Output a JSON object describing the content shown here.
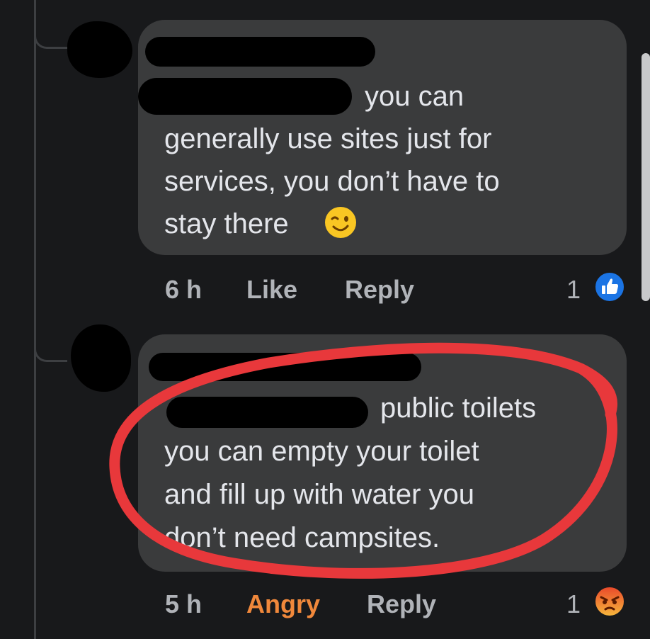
{
  "comments": [
    {
      "text_lines": [
        "you can",
        "generally use sites just for",
        "services, you don’t have to",
        "stay there"
      ],
      "emoji": "winking-face",
      "time": "6 h",
      "like_label": "Like",
      "reply_label": "Reply",
      "reaction_count": "1",
      "reaction": "like",
      "reaction_color": "#1b74e4"
    },
    {
      "text_lines": [
        "public toilets",
        "you can empty your toilet",
        "and fill up with water you",
        "don’t need campsites."
      ],
      "time": "5 h",
      "like_label": "Angry",
      "reply_label": "Reply",
      "reaction_count": "1",
      "reaction": "angry",
      "reaction_color": "#f15b2a"
    }
  ],
  "colors": {
    "background": "#18191b",
    "bubble": "#3a3b3c",
    "text": "#e4e6eb",
    "meta": "#b0b3b8",
    "angry_label": "#f0883b",
    "annotation": "#e8383b"
  }
}
